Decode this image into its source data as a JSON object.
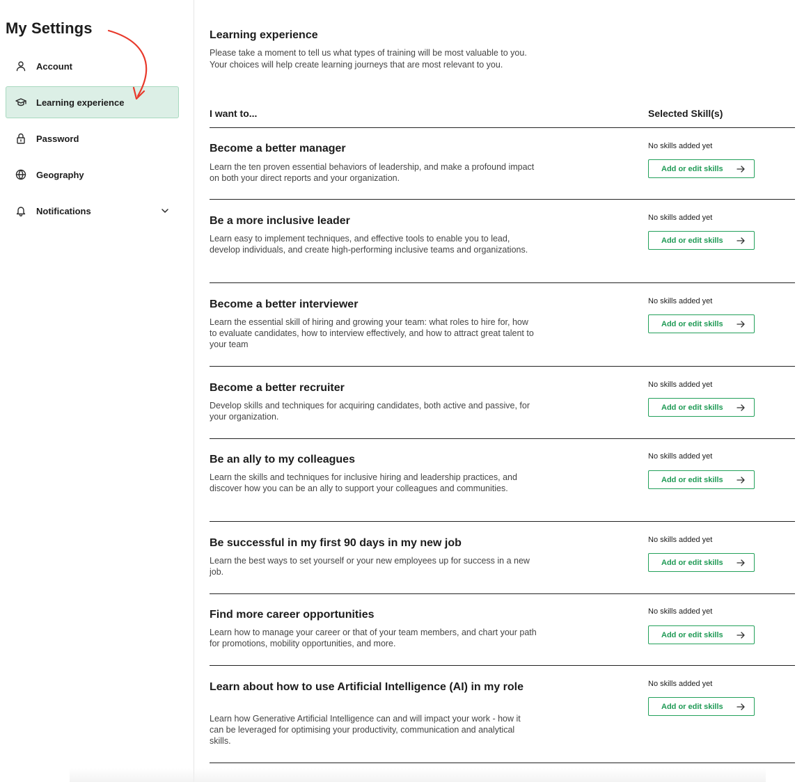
{
  "sidebar": {
    "title": "My Settings",
    "items": [
      {
        "label": "Account",
        "icon": "user-icon"
      },
      {
        "label": "Learning experience",
        "icon": "graduation-cap-icon",
        "active": true
      },
      {
        "label": "Password",
        "icon": "lock-icon"
      },
      {
        "label": "Geography",
        "icon": "globe-icon"
      },
      {
        "label": "Notifications",
        "icon": "bell-icon",
        "expandable": true
      }
    ]
  },
  "main": {
    "title": "Learning experience",
    "intro": "Please take a moment to tell us what types of training will be most valuable to you. Your choices will help create learning journeys that are most relevant to you.",
    "col_left": "I want to...",
    "col_right": "Selected Skill(s)",
    "goals": [
      {
        "title": "Become a better manager",
        "description": "Learn the ten proven essential behaviors of leadership, and make a profound impact on both your direct reports and your organization.",
        "status": "No skills added yet",
        "button": "Add or edit skills"
      },
      {
        "title": "Be a more inclusive leader",
        "description": "Learn easy to implement techniques, and effective tools to enable you to lead, develop individuals, and create high-performing inclusive teams and organizations.",
        "status": "No skills added yet",
        "button": "Add or edit skills"
      },
      {
        "title": "Become a better interviewer",
        "description": "Learn the essential skill of hiring and growing your team: what roles to hire for, how to evaluate candidates, how to interview effectively, and how to attract great talent to your team",
        "status": "No skills added yet",
        "button": "Add or edit skills"
      },
      {
        "title": "Become a better recruiter",
        "description": "Develop skills and techniques for acquiring candidates, both active and passive, for your organization.",
        "status": "No skills added yet",
        "button": "Add or edit skills"
      },
      {
        "title": "Be an ally to my colleagues",
        "description": "Learn the skills and techniques for inclusive hiring and leadership practices, and discover how you can be an ally to support your colleagues and communities.",
        "status": "No skills added yet",
        "button": "Add or edit skills"
      },
      {
        "title": "Be successful in my first 90 days in my new job",
        "description": "Learn the best ways to set yourself or your new employees up for success in a new job.",
        "status": "No skills added yet",
        "button": "Add or edit skills"
      },
      {
        "title": "Find more career opportunities",
        "description": "Learn how to manage your career or that of your team members, and chart your path for promotions, mobility opportunities, and more.",
        "status": "No skills added yet",
        "button": "Add or edit skills"
      },
      {
        "title": "Learn about how to use Artificial Intelligence (AI) in my role",
        "description": "Learn how Generative Artificial Intelligence can and will impact your work - how it can be leveraged for optimising your productivity, communication and analytical skills.",
        "status": "No skills added yet",
        "button": "Add or edit skills"
      }
    ]
  },
  "colors": {
    "active_bg": "#dcefe6",
    "active_border": "#a7d9bf",
    "button_green": "#1f9a55",
    "annotation_red": "#e8392b"
  }
}
